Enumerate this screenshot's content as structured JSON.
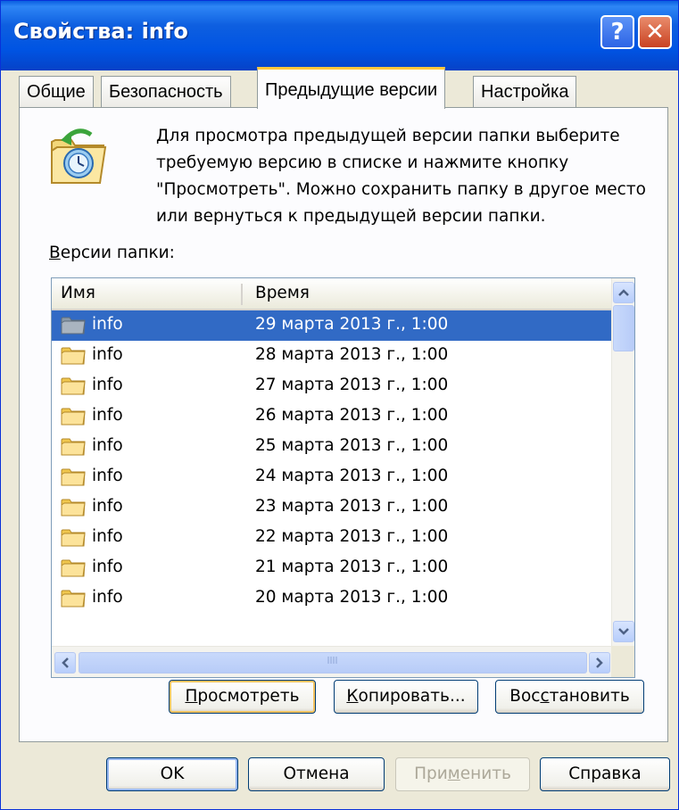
{
  "window": {
    "title": "Свойства: info",
    "help_glyph": "?",
    "close_glyph": "✕"
  },
  "tabs": [
    {
      "label": "Общие"
    },
    {
      "label": "Безопасность"
    },
    {
      "label": "Предыдущие версии"
    },
    {
      "label": "Настройка"
    }
  ],
  "panel": {
    "description": "Для просмотра предыдущей версии папки выберите требуемую версию в списке и нажмите кнопку \"Просмотреть\".  Можно сохранить папку в другое место или вернуться к предыдущей версии папки.",
    "versions_label_first": "В",
    "versions_label_rest": "ерсии папки:"
  },
  "list": {
    "columns": {
      "name": "Имя",
      "time": "Время"
    },
    "rows": [
      {
        "name": "info",
        "time": "29 марта 2013 г., 1:00"
      },
      {
        "name": "info",
        "time": "28 марта 2013 г., 1:00"
      },
      {
        "name": "info",
        "time": "27 марта 2013 г., 1:00"
      },
      {
        "name": "info",
        "time": "26 марта 2013 г., 1:00"
      },
      {
        "name": "info",
        "time": "25 марта 2013 г., 1:00"
      },
      {
        "name": "info",
        "time": "24 марта 2013 г., 1:00"
      },
      {
        "name": "info",
        "time": "23 марта 2013 г., 1:00"
      },
      {
        "name": "info",
        "time": "22 марта 2013 г., 1:00"
      },
      {
        "name": "info",
        "time": "21 марта 2013 г., 1:00"
      },
      {
        "name": "info",
        "time": "20 марта 2013 г., 1:00"
      }
    ]
  },
  "actions": {
    "view": {
      "u": "П",
      "rest": "росмотреть"
    },
    "copy": {
      "u": "К",
      "rest": "опировать..."
    },
    "restore": {
      "pre": "Вос",
      "u": "с",
      "rest": "тановить"
    }
  },
  "footer": {
    "ok": "OK",
    "cancel": "Отмена",
    "apply": {
      "pre": "При",
      "u": "м",
      "rest": "енить"
    },
    "help": "Справка"
  }
}
